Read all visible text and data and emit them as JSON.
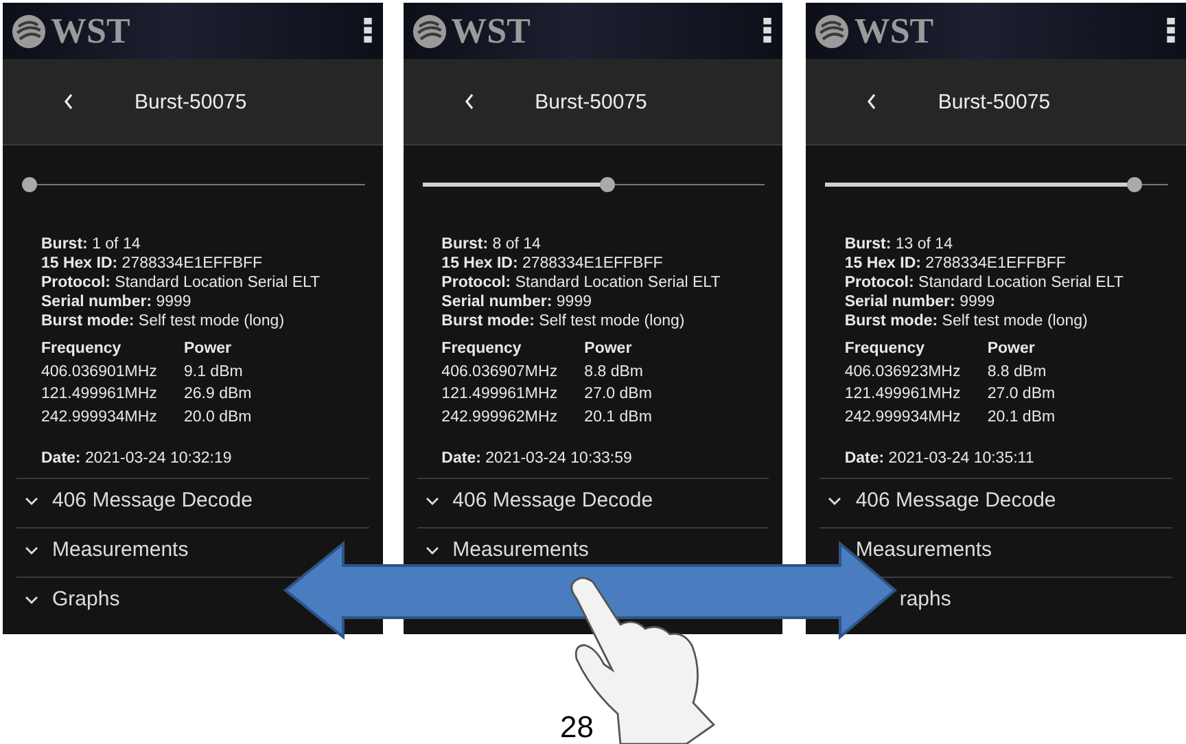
{
  "screens": [
    {
      "logo": "WST",
      "title": "Burst-50075",
      "slider": {
        "level": 0.0
      },
      "info": [
        {
          "label": "Burst:",
          "value": "1 of 14"
        },
        {
          "label": "15 Hex ID:",
          "value": "2788334E1EFFBFF"
        },
        {
          "label": "Protocol:",
          "value": "Standard Location Serial ELT"
        },
        {
          "label": "Serial number:",
          "value": "9999"
        },
        {
          "label": "Burst mode:",
          "value": "Self test mode (long)"
        }
      ],
      "table": {
        "columns": [
          "Frequency",
          "Power"
        ],
        "rows": [
          [
            "406.036901MHz",
            "9.1 dBm"
          ],
          [
            "121.499961MHz",
            "26.9 dBm"
          ],
          [
            "242.999934MHz",
            "20.0 dBm"
          ]
        ]
      },
      "date": {
        "label": "Date:",
        "value": "2021-03-24 10:32:19"
      },
      "sections": [
        {
          "label": "406 Message Decode",
          "chevron": true
        },
        {
          "label": "Measurements",
          "chevron": true
        },
        {
          "label": "Graphs",
          "chevron": true
        }
      ]
    },
    {
      "logo": "WST",
      "title": "Burst-50075",
      "slider": {
        "level": 0.54
      },
      "info": [
        {
          "label": "Burst:",
          "value": "8 of 14"
        },
        {
          "label": "15 Hex ID:",
          "value": "2788334E1EFFBFF"
        },
        {
          "label": "Protocol:",
          "value": "Standard Location Serial ELT"
        },
        {
          "label": "Serial number:",
          "value": "9999"
        },
        {
          "label": "Burst mode:",
          "value": "Self test mode (long)"
        }
      ],
      "table": {
        "columns": [
          "Frequency",
          "Power"
        ],
        "rows": [
          [
            "406.036907MHz",
            "8.8 dBm"
          ],
          [
            "121.499961MHz",
            "27.0 dBm"
          ],
          [
            "242.999962MHz",
            "20.1 dBm"
          ]
        ]
      },
      "date": {
        "label": "Date:",
        "value": "2021-03-24 10:33:59"
      },
      "sections": [
        {
          "label": "406 Message Decode",
          "chevron": true
        },
        {
          "label": "Measurements",
          "chevron": true
        }
      ]
    },
    {
      "logo": "WST",
      "title": "Burst-50075",
      "slider": {
        "level": 0.92
      },
      "info": [
        {
          "label": "Burst:",
          "value": "13 of 14"
        },
        {
          "label": "15 Hex ID:",
          "value": "2788334E1EFFBFF"
        },
        {
          "label": "Protocol:",
          "value": "Standard Location Serial ELT"
        },
        {
          "label": "Serial number:",
          "value": "9999"
        },
        {
          "label": "Burst mode:",
          "value": "Self test mode (long)"
        }
      ],
      "table": {
        "columns": [
          "Frequency",
          "Power"
        ],
        "rows": [
          [
            "406.036923MHz",
            "8.8 dBm"
          ],
          [
            "121.499961MHz",
            "27.0 dBm"
          ],
          [
            "242.999934MHz",
            "20.1 dBm"
          ]
        ]
      },
      "date": {
        "label": "Date:",
        "value": "2021-03-24 10:35:11"
      },
      "sections": [
        {
          "label": "406 Message Decode",
          "chevron": true
        },
        {
          "label": "Measurements",
          "chevron": false
        },
        {
          "label": "raphs",
          "chevron": false
        }
      ]
    }
  ],
  "page_number": "28"
}
